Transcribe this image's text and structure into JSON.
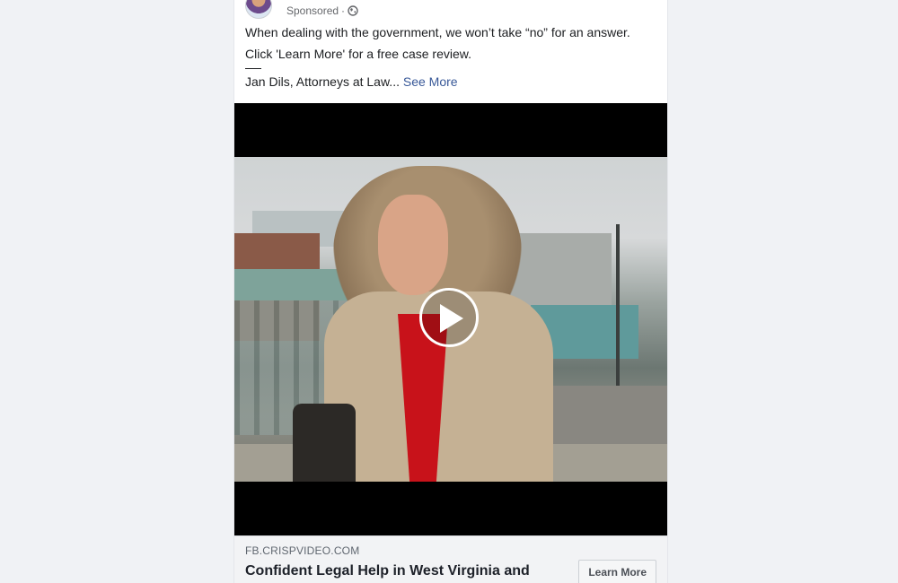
{
  "post": {
    "sponsored_label": "Sponsored",
    "separator": "·",
    "audience_icon": "globe-icon",
    "text_line1": "When dealing with the government, we won’t take “no” for an answer.",
    "text_line2": "Click 'Learn More' for a free case review.",
    "attribution": "Jan Dils, Attorneys at Law...",
    "see_more": "See More"
  },
  "video": {
    "play_icon": "play-icon"
  },
  "link_preview": {
    "domain": "FB.CRISPVIDEO.COM",
    "headline": "Confident Legal Help in West Virginia and",
    "cta_label": "Learn More"
  },
  "colors": {
    "link": "#385898",
    "page_bg": "#f0f2f5",
    "video_bg": "#000000"
  }
}
